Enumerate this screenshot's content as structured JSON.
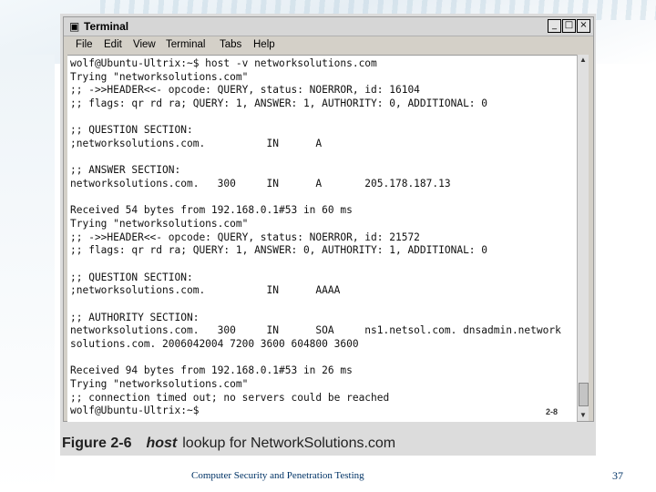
{
  "window": {
    "title": "Terminal",
    "buttons": [
      "_",
      "□",
      "×"
    ],
    "menu": [
      "File",
      "Edit",
      "View",
      "Terminal",
      "Tabs",
      "Help"
    ]
  },
  "terminal_lines": [
    "wolf@Ubuntu-Ultrix:~$ host -v networksolutions.com",
    "Trying \"networksolutions.com\"",
    ";; ->>HEADER<<- opcode: QUERY, status: NOERROR, id: 16104",
    ";; flags: qr rd ra; QUERY: 1, ANSWER: 1, AUTHORITY: 0, ADDITIONAL: 0",
    "",
    ";; QUESTION SECTION:",
    ";networksolutions.com.          IN      A",
    "",
    ";; ANSWER SECTION:",
    "networksolutions.com.   300     IN      A       205.178.187.13",
    "",
    "Received 54 bytes from 192.168.0.1#53 in 60 ms",
    "Trying \"networksolutions.com\"",
    ";; ->>HEADER<<- opcode: QUERY, status: NOERROR, id: 21572",
    ";; flags: qr rd ra; QUERY: 1, ANSWER: 0, AUTHORITY: 1, ADDITIONAL: 0",
    "",
    ";; QUESTION SECTION:",
    ";networksolutions.com.          IN      AAAA",
    "",
    ";; AUTHORITY SECTION:",
    "networksolutions.com.   300     IN      SOA     ns1.netsol.com. dnsadmin.network",
    "solutions.com. 2006042004 7200 3600 604800 3600",
    "",
    "Received 94 bytes from 192.168.0.1#53 in 26 ms",
    "Trying \"networksolutions.com\"",
    ";; connection timed out; no servers could be reached",
    "wolf@Ubuntu-Ultrix:~$"
  ],
  "figure_tag": "2-8",
  "caption": {
    "number": "Figure 2-6",
    "command": "host",
    "text": "lookup for NetworkSolutions.com"
  },
  "footer": {
    "text": "Computer Security and Penetration Testing",
    "page": "37"
  }
}
